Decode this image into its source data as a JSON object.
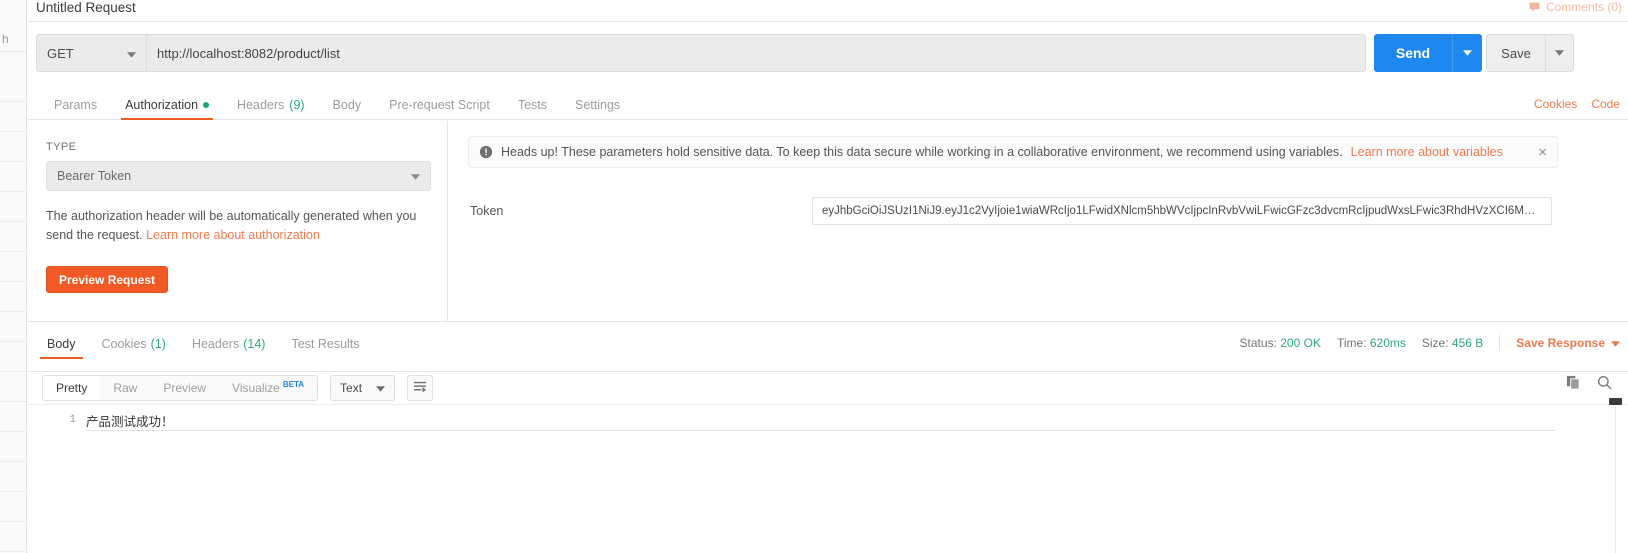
{
  "sidebar": {
    "search_label": "h"
  },
  "request": {
    "title": "Untitled Request",
    "comments_label": "Comments (0)",
    "method": "GET",
    "url": "http://localhost:8082/product/list",
    "send_label": "Send",
    "save_label": "Save",
    "tabs": [
      {
        "label": "Params",
        "badge": "",
        "dot": false,
        "active": false
      },
      {
        "label": "Authorization",
        "badge": "",
        "dot": true,
        "active": true
      },
      {
        "label": "Headers",
        "badge": "(9)",
        "dot": false,
        "active": false
      },
      {
        "label": "Body",
        "badge": "",
        "dot": false,
        "active": false
      },
      {
        "label": "Pre-request Script",
        "badge": "",
        "dot": false,
        "active": false
      },
      {
        "label": "Tests",
        "badge": "",
        "dot": false,
        "active": false
      },
      {
        "label": "Settings",
        "badge": "",
        "dot": false,
        "active": false
      }
    ],
    "cookies_link": "Cookies",
    "code_link": "Code"
  },
  "auth": {
    "type_label": "TYPE",
    "type_value": "Bearer Token",
    "help_text": "The authorization header will be automatically generated when you send the request.",
    "help_link": "Learn more about authorization",
    "preview_button": "Preview Request",
    "notice_text": "Heads up! These parameters hold sensitive data. To keep this data secure while working in a collaborative environment, we recommend using variables.",
    "notice_link": "Learn more about variables",
    "notice_close": "×",
    "token_label": "Token",
    "token_value": "eyJhbGciOiJSUzI1NiJ9.eyJ1c2VyIjoie1wiaWRcIjo1LFwidXNlcm5hbWVcIjpcInRvbVwiLFwicGFzc3dvcmRcIjpudWxsLFwic3RhdHVzXCI6M…"
  },
  "response": {
    "tabs": [
      {
        "label": "Body",
        "badge": "",
        "active": true
      },
      {
        "label": "Cookies",
        "badge": "(1)",
        "active": false
      },
      {
        "label": "Headers",
        "badge": "(14)",
        "active": false
      },
      {
        "label": "Test Results",
        "badge": "",
        "active": false
      }
    ],
    "status_label": "Status:",
    "status_value": "200 OK",
    "time_label": "Time:",
    "time_value": "620ms",
    "size_label": "Size:",
    "size_value": "456 B",
    "save_response_label": "Save Response",
    "formats": [
      {
        "label": "Pretty",
        "beta": "",
        "active": true
      },
      {
        "label": "Raw",
        "beta": "",
        "active": false
      },
      {
        "label": "Preview",
        "beta": "",
        "active": false
      },
      {
        "label": "Visualize",
        "beta": "BETA",
        "active": false
      }
    ],
    "content_type": "Text",
    "body_lines": [
      {
        "number": "1",
        "text": "产品测试成功！"
      }
    ]
  },
  "colors": {
    "accent_orange": "#ef5b25",
    "link_orange": "#ef7a4f",
    "send_blue": "#1e87f0",
    "green": "#2fa87b",
    "beta_blue": "#1e87f0"
  }
}
